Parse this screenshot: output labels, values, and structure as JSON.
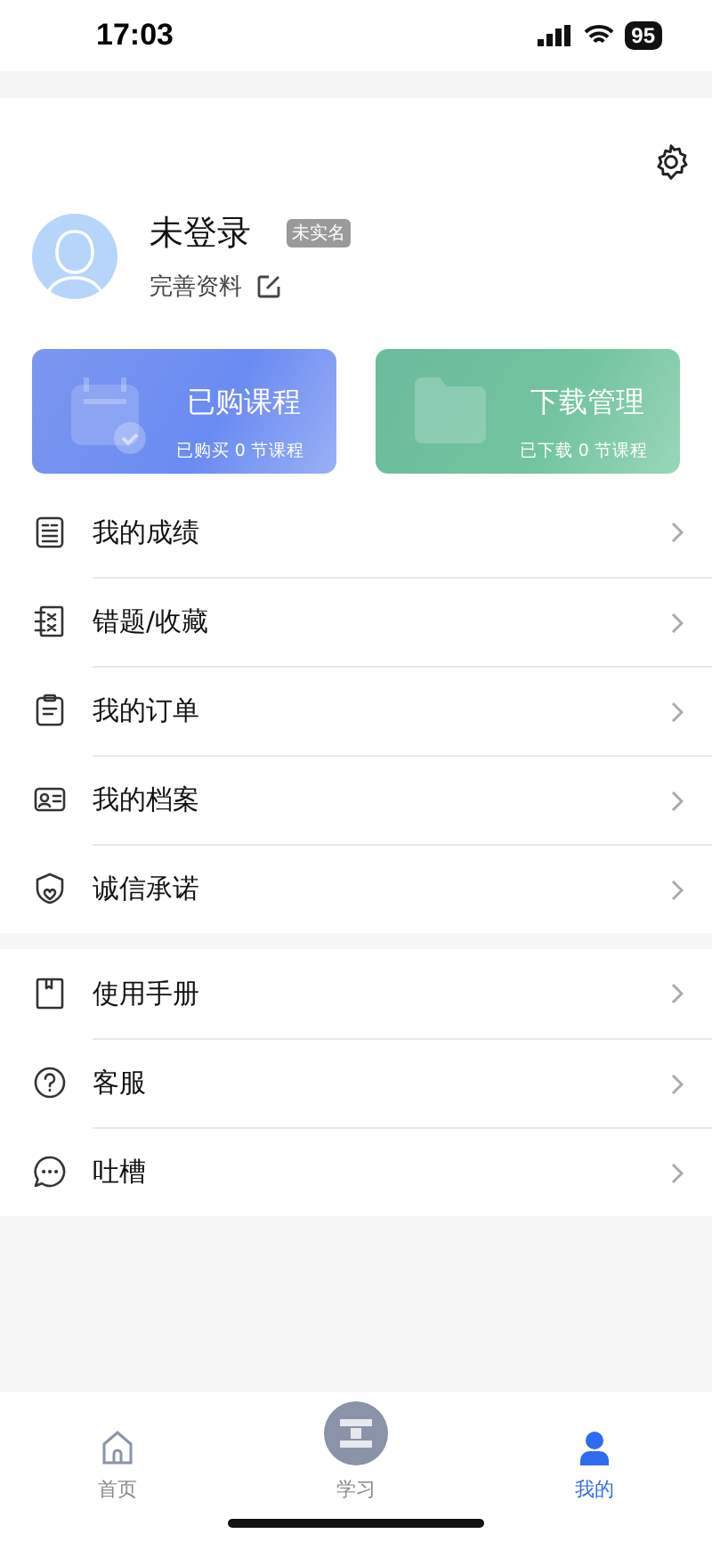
{
  "status_bar": {
    "time": "17:03",
    "battery": "95"
  },
  "profile": {
    "name": "未登录",
    "badge": "未实名",
    "edit_label": "完善资料"
  },
  "cards": [
    {
      "kind": "courses",
      "title": "已购课程",
      "subtitle": "已购买 0 节课程"
    },
    {
      "kind": "downloads",
      "title": "下载管理",
      "subtitle": "已下载 0 节课程"
    }
  ],
  "menu_groups": [
    [
      {
        "kind": "scores",
        "label": "我的成绩"
      },
      {
        "kind": "mistakes",
        "label": "错题/收藏"
      },
      {
        "kind": "orders",
        "label": "我的订单"
      },
      {
        "kind": "profile",
        "label": "我的档案"
      },
      {
        "kind": "pledge",
        "label": "诚信承诺"
      }
    ],
    [
      {
        "kind": "manual",
        "label": "使用手册"
      },
      {
        "kind": "help",
        "label": "客服"
      },
      {
        "kind": "feedback",
        "label": "吐槽"
      }
    ]
  ],
  "tab_bar": [
    {
      "kind": "home",
      "label": "首页",
      "selected": false
    },
    {
      "kind": "study",
      "label": "学习",
      "selected": false
    },
    {
      "kind": "me",
      "label": "我的",
      "selected": true
    }
  ]
}
